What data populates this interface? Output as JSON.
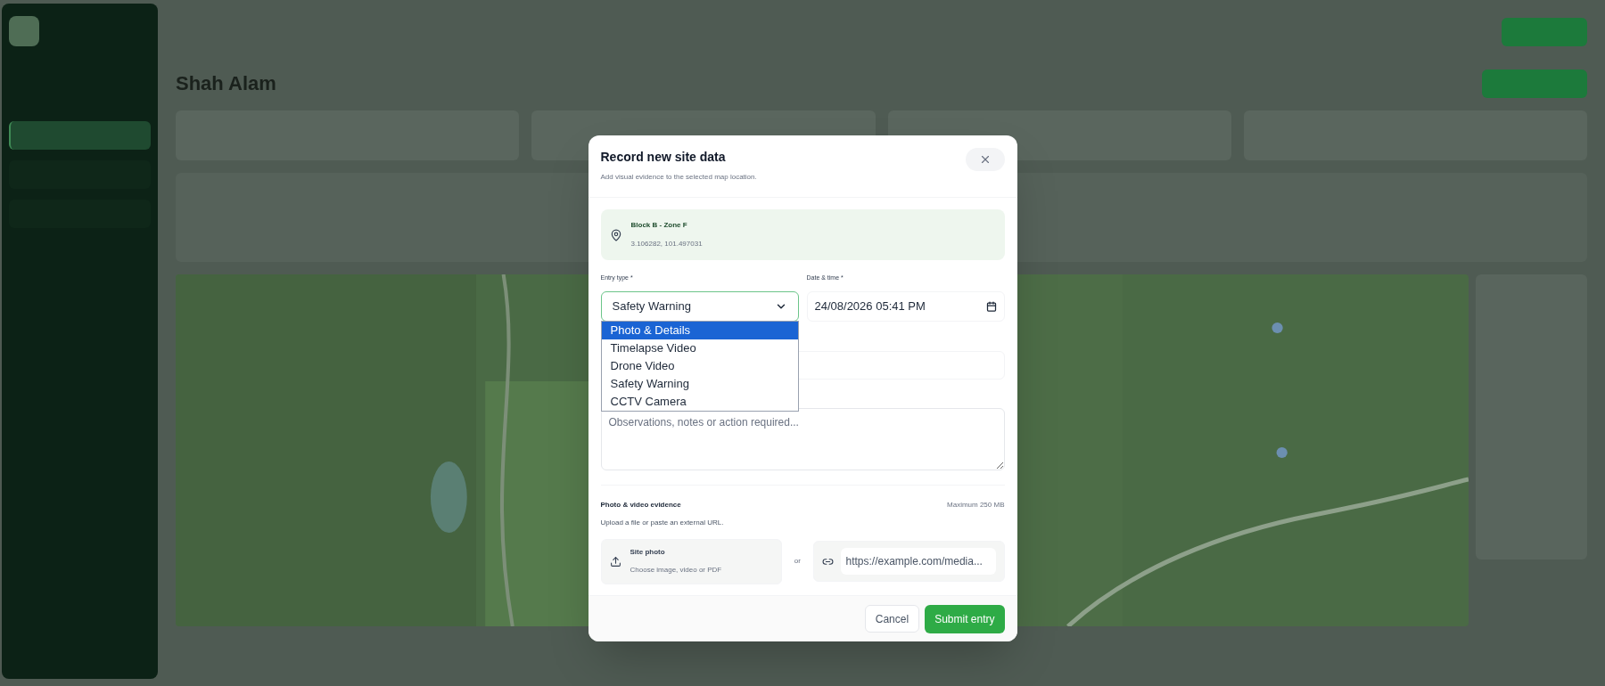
{
  "sidebar": {
    "items": [
      {
        "selected": true
      },
      {
        "selected": false
      },
      {
        "selected": false
      }
    ]
  },
  "page": {
    "heading": "Shah Alam"
  },
  "dialog": {
    "title": "Record new site data",
    "subtitle": "Add visual evidence to the selected map location.",
    "location": {
      "name": "Block B - Zone F",
      "coordinates": "3.106282, 101.497031"
    },
    "entry_type": {
      "label": "Entry type *",
      "value": "Safety Warning",
      "expanded": true,
      "options": [
        {
          "label": "Photo & Details",
          "highlighted": true
        },
        {
          "label": "Timelapse Video",
          "highlighted": false
        },
        {
          "label": "Drone Video",
          "highlighted": false
        },
        {
          "label": "Safety Warning",
          "highlighted": false
        },
        {
          "label": "CCTV Camera",
          "highlighted": false
        }
      ]
    },
    "date_time": {
      "label": "Date & time *",
      "value": "24/08/2026 05:41 PM"
    },
    "notes": {
      "placeholder": "Observations, notes or action required..."
    },
    "evidence": {
      "title": "Photo & video evidence",
      "limit": "Maximum 250 MB",
      "hint": "Upload a file or paste an external URL.",
      "upload": {
        "title": "Site photo",
        "hint": "Choose image, video or PDF"
      },
      "separator": "or",
      "url": {
        "placeholder": "https://example.com/media..."
      }
    },
    "buttons": [
      {
        "label": "Cancel",
        "kind": "secondary"
      },
      {
        "label": "Submit entry",
        "kind": "primary"
      }
    ]
  }
}
